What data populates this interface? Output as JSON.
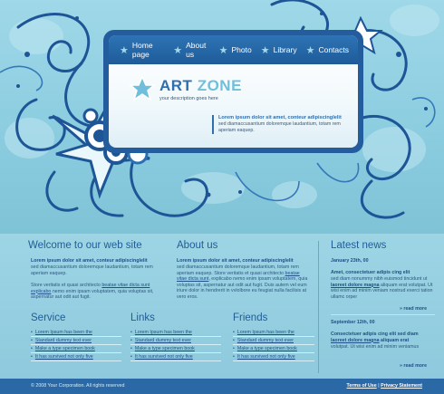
{
  "nav": [
    "Home page",
    "About us",
    "Photo",
    "Library",
    "Contacts"
  ],
  "logo": {
    "title_a": "ART",
    "title_b": "ZONE",
    "tagline": "your description goes here"
  },
  "panel": {
    "heading": "Lorem ipsum dolor sit amet, conteur adipiscinglelit",
    "text": "sed diamaccusantium doloremque laudantium, totam rem aperiam eaquep."
  },
  "welcome": {
    "title": "Welcome to our web site",
    "heading": "Lorem ipsum dolor sit amet, conteur adipiscinglelit",
    "p1": "sed diamaccusantium doloremque laudantium, totam rem aperiam eaquep.",
    "p2_a": "Store veritatis et quasi architecto ",
    "p2_link": "beatae vitae dicta sunt explicabo",
    "p2_b": " nemo enim ipsam voluptatem, quia voluptas sit, aspernatur aut odit aut fugit."
  },
  "about": {
    "title": "About us",
    "heading": "Lorem ipsum dolor sit amet, conteur adipiscinglelit",
    "p1_a": "sed diamaccusantium doloremque laudantium, totam rem aperiam eaquep. Store veritatis et quasi architecto ",
    "p1_link": "beatae vitae dicta sunt",
    "p1_b": ", explicabo nemo enim ipsam voluptatem, quia voluptas sit, aspernatur aut odit aut fugit. Duis autem vel eum iriure dolor in hendrerit in vvlolbore eu feugiat nulla facilisis at vero eros."
  },
  "service": {
    "title": "Service",
    "items": [
      "Lorem Ipsum has been the",
      "Standard dummy text ever",
      "Make a type specimen book",
      "It has survived not only five"
    ]
  },
  "links": {
    "title": "Links",
    "items": [
      "Lorem Ipsum has been the",
      "Standard dummy text ever",
      "Make a type specimen book",
      "It has survived not only five"
    ]
  },
  "friends": {
    "title": "Friends",
    "items": [
      "Lorem Ipsum has been the",
      "Standard dummy text ever",
      "Make a type specimen book",
      "It has survived not only five"
    ]
  },
  "news": {
    "title": "Latest news",
    "items": [
      {
        "date": "January 23th, 00",
        "heading": "Amet, consectetuer adipis cing elit",
        "text_a": "sed diam nonummy nibh euismod tincidunt ut ",
        "text_link": "laoreet dolore magna",
        "text_b": " aliquam erat volutpat. Ut wisi enim ad minim veniam nostrud exerci tation ullamc orper",
        "more": "read more"
      },
      {
        "date": "September 12th, 00",
        "heading": "Consectetuer adipis cing elit sed diam ",
        "heading_link": "laoreet dolore magna",
        "heading_b": " aliquam erat",
        "text": "volutpat. Ut wisi enim ad minim veniamus",
        "more": "read more"
      }
    ]
  },
  "footer": {
    "copyright": "© 2008 Your Corporation. All rights reserved",
    "terms": "Terms of Use",
    "separator": "|",
    "privacy": "Privacy Statement"
  },
  "colors": {
    "bg": "#8ac9dc",
    "dark_blue": "#245d9e",
    "nav": "#2d74b5",
    "light": "#bfe6f0"
  }
}
